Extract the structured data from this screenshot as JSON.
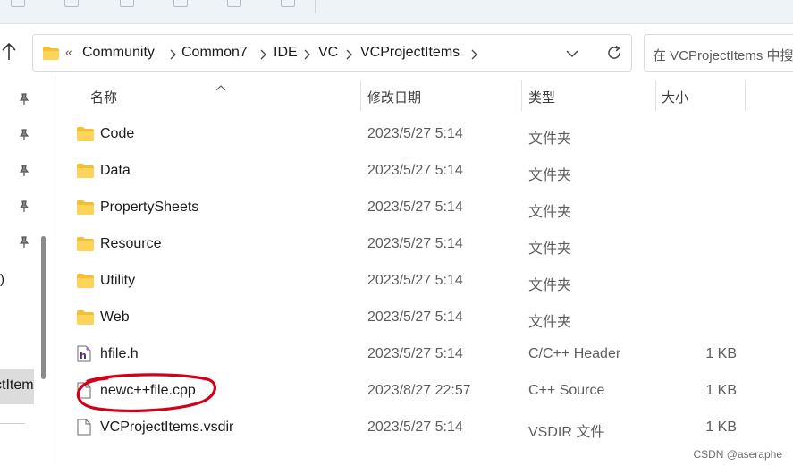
{
  "address_bar": {
    "overflow": "«",
    "crumbs": [
      "Community",
      "Common7",
      "IDE",
      "VC",
      "VCProjectItems"
    ]
  },
  "search": {
    "placeholder": "在 VCProjectItems 中搜"
  },
  "sidebar": {
    "partial_label": "ctItem",
    "partial_paren": ")"
  },
  "columns": {
    "name": "名称",
    "date": "修改日期",
    "type": "类型",
    "size": "大小"
  },
  "files": [
    {
      "icon": "folder-icon",
      "name": "Code",
      "date": "2023/5/27 5:14",
      "type": "文件夹",
      "size": ""
    },
    {
      "icon": "folder-icon",
      "name": "Data",
      "date": "2023/5/27 5:14",
      "type": "文件夹",
      "size": ""
    },
    {
      "icon": "folder-icon",
      "name": "PropertySheets",
      "date": "2023/5/27 5:14",
      "type": "文件夹",
      "size": ""
    },
    {
      "icon": "folder-icon",
      "name": "Resource",
      "date": "2023/5/27 5:14",
      "type": "文件夹",
      "size": ""
    },
    {
      "icon": "folder-icon",
      "name": "Utility",
      "date": "2023/5/27 5:14",
      "type": "文件夹",
      "size": ""
    },
    {
      "icon": "folder-icon",
      "name": "Web",
      "date": "2023/5/27 5:14",
      "type": "文件夹",
      "size": ""
    },
    {
      "icon": "header-file-icon",
      "name": "hfile.h",
      "date": "2023/5/27 5:14",
      "type": "C/C++ Header",
      "size": "1 KB"
    },
    {
      "icon": "blank-file-icon",
      "name": "newc++file.cpp",
      "date": "2023/8/27 22:57",
      "type": "C++ Source",
      "size": "1 KB"
    },
    {
      "icon": "blank-file-icon",
      "name": "VCProjectItems.vsdir",
      "date": "2023/5/27 5:14",
      "type": "VSDIR 文件",
      "size": "1 KB"
    }
  ],
  "annotation_color": "#d0021b",
  "watermark": "CSDN @aseraphe"
}
